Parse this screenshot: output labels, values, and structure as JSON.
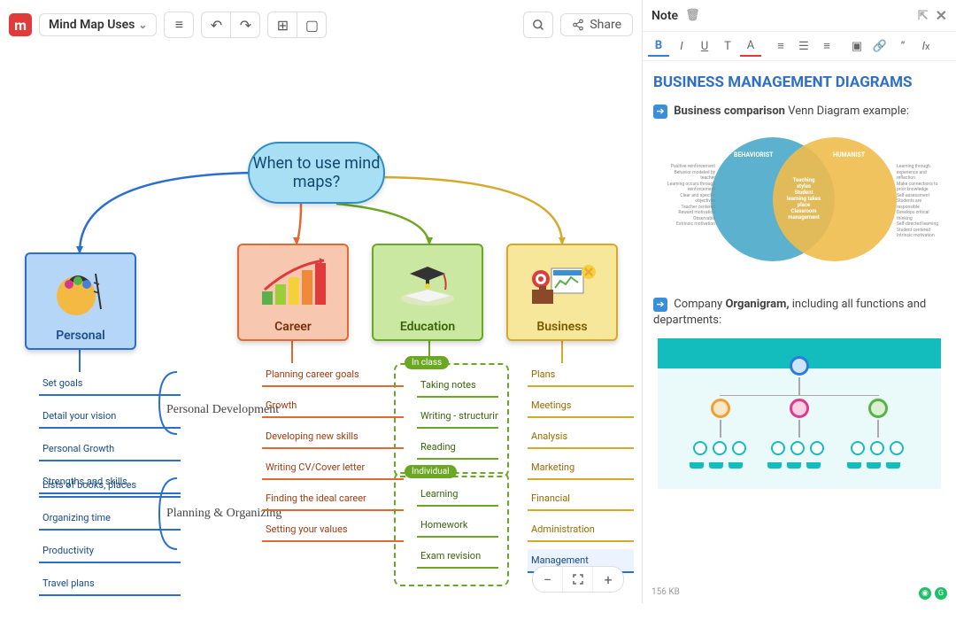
{
  "toolbar": {
    "title": "Mind Map Uses",
    "share_label": "Share"
  },
  "root": {
    "label": "When to use mind maps?"
  },
  "branches": {
    "personal": {
      "label": "Personal",
      "group1_label": "Personal Development",
      "group2_label": "Planning & Organizing",
      "items1": [
        "Set goals",
        "Detail your vision",
        "Personal Growth",
        "Strengths and skills"
      ],
      "items2": [
        "Lists of books, places",
        "Organizing time",
        "Productivity",
        "Travel plans"
      ]
    },
    "career": {
      "label": "Career",
      "items": [
        "Planning career goals",
        "Growth",
        "Developing new skills",
        "Writing CV/Cover letter",
        "Finding the ideal career",
        "Setting  your values"
      ]
    },
    "education": {
      "label": "Education",
      "group1": "In class",
      "group2": "Individual",
      "items1": [
        "Taking notes",
        "Writing - structuring",
        "Reading"
      ],
      "items2": [
        "Learning",
        "Homework",
        "Exam revision"
      ]
    },
    "business": {
      "label": "Business",
      "items": [
        "Plans",
        "Meetings",
        "Analysis",
        "Marketing",
        "Financial",
        "Administration",
        "Management"
      ]
    }
  },
  "note": {
    "header": "Note",
    "title": "BUSINESS MANAGEMENT DIAGRAMS",
    "line1_bold": "Business comparison",
    "line1_rest": " Venn Diagram example:",
    "venn_left": "BEHAVIORIST",
    "venn_right": "HUMANIST",
    "line2_pre": "Company ",
    "line2_bold": "Organigram,",
    "line2_rest": " including all functions and departments:",
    "footer": "156 KB"
  }
}
